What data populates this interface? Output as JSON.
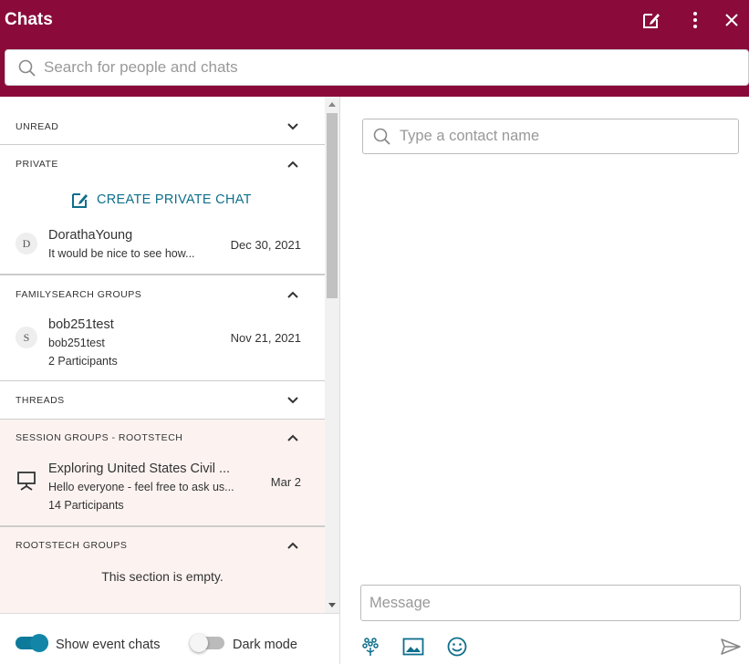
{
  "header": {
    "title": "Chats",
    "icons": [
      "new-chat-icon",
      "more-vertical-icon",
      "close-icon"
    ],
    "search_placeholder": "Search for people and chats"
  },
  "sections": {
    "unread": {
      "label": "UNREAD",
      "expanded": false
    },
    "private": {
      "label": "PRIVATE",
      "expanded": true,
      "create_label": "CREATE PRIVATE CHAT",
      "chats": [
        {
          "avatar": "D",
          "name": "DorathaYoung",
          "preview": "It would be nice to see how...",
          "date": "Dec 30, 2021"
        }
      ]
    },
    "familysearch": {
      "label": "FAMILYSEARCH GROUPS",
      "expanded": true,
      "chats": [
        {
          "avatar": "S",
          "name": "bob251test",
          "preview": "bob251test",
          "participants": "2 Participants",
          "date": "Nov 21, 2021"
        }
      ]
    },
    "threads": {
      "label": "THREADS",
      "expanded": false
    },
    "session": {
      "label": "SESSION GROUPS - ROOTSTECH",
      "expanded": true,
      "chats": [
        {
          "icon": "presentation-icon",
          "name": "Exploring United States Civil ...",
          "preview": "Hello everyone - feel free to ask us...",
          "participants": "14 Participants",
          "date": "Mar 2"
        }
      ]
    },
    "rootstech": {
      "label": "ROOTSTECH GROUPS",
      "expanded": true,
      "empty_text": "This section is empty."
    }
  },
  "footer": {
    "show_event_chats": {
      "label": "Show event chats",
      "on": true
    },
    "dark_mode": {
      "label": "Dark mode",
      "on": false
    }
  },
  "right": {
    "contact_placeholder": "Type a contact name",
    "message_placeholder": "Message",
    "tools": [
      "familytree-icon",
      "image-icon",
      "emoji-icon",
      "send-icon"
    ]
  },
  "colors": {
    "brand": "#8a0b3a",
    "accent": "#0e6f8c",
    "session_bg": "#fcf3f1"
  }
}
